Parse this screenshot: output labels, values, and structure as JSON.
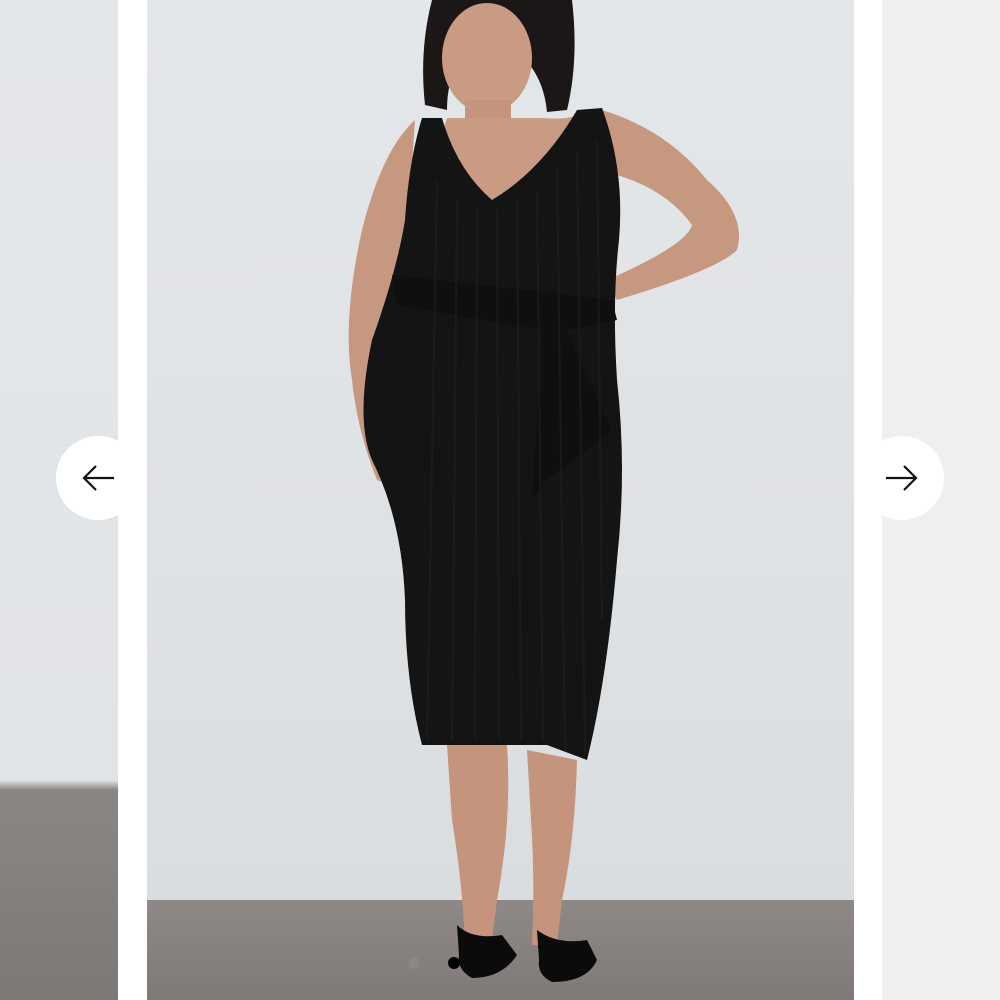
{
  "carousel": {
    "slide_count": 2,
    "active_index": 1,
    "main_image": {
      "subject": "model-wearing-black-ribbed-midi-dress",
      "dress_color": "#141414",
      "background_color": "#e0e3e6",
      "floor_color": "#857f7c"
    },
    "prev_button": {
      "icon": "arrow-left-icon"
    },
    "next_button": {
      "icon": "arrow-right-icon"
    },
    "dots": [
      {
        "state": "inactive",
        "color": "#8a8785"
      },
      {
        "state": "active",
        "color": "#000000"
      }
    ]
  }
}
